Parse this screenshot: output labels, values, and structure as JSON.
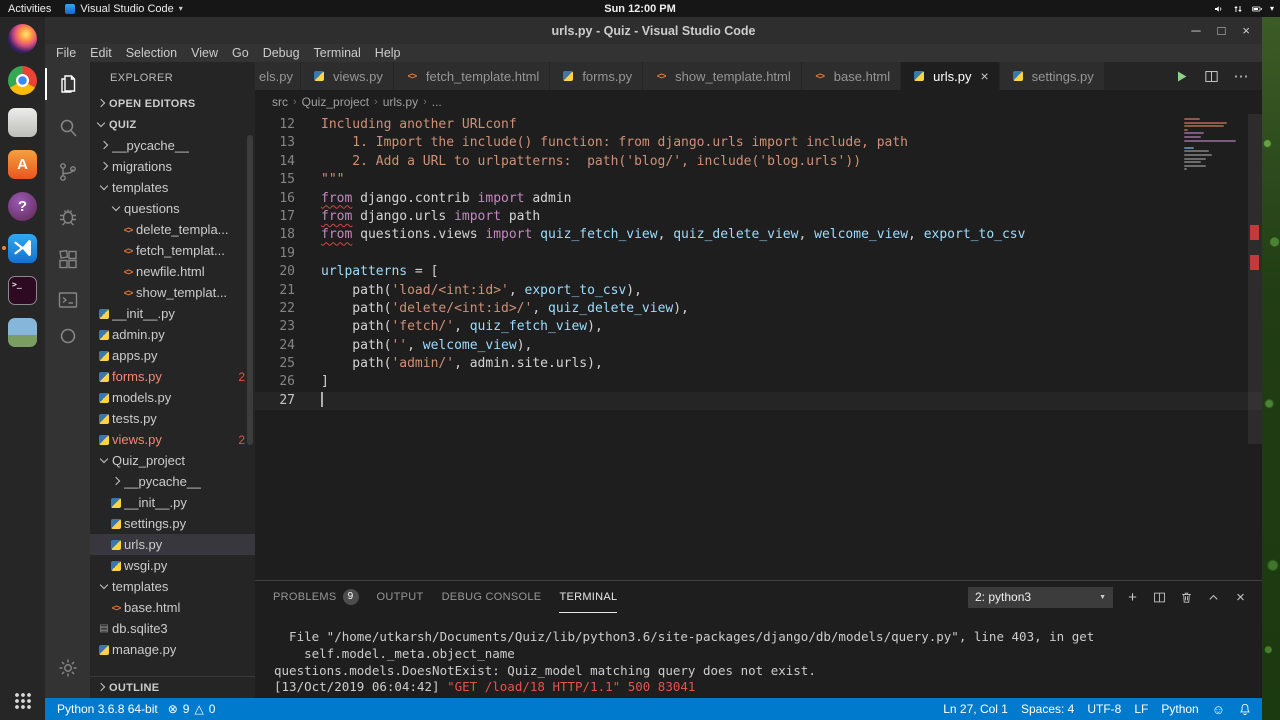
{
  "colors": {
    "status_bar_accent": "#007acc",
    "error_red": "#f14c4c",
    "list_error_foreground": "#f48771",
    "string_color": "#ce9178",
    "keyword_color": "#c586c0",
    "variable_color": "#9cdcfe"
  },
  "desktop": {
    "activities_label": "Activities",
    "focused_app_label": "Visual Studio Code",
    "clock": "Sun 12:00 PM",
    "indicator_icons": [
      "volume-icon",
      "network-icon",
      "battery-icon"
    ],
    "dock": [
      {
        "icon": "firefox-icon"
      },
      {
        "icon": "chrome-icon"
      },
      {
        "icon": "files-app-icon"
      },
      {
        "icon": "ubuntu-software-icon",
        "letter": "A"
      },
      {
        "icon": "help-icon",
        "letter": "?"
      },
      {
        "icon": "vscode-icon",
        "running": true
      },
      {
        "icon": "terminal-app-icon",
        "letter": ">_"
      },
      {
        "icon": "image-viewer-icon"
      }
    ]
  },
  "window": {
    "title": "urls.py - Quiz - Visual Studio Code",
    "controls": [
      {
        "name": "minimize-button",
        "glyph": "─"
      },
      {
        "name": "maximize-button",
        "glyph": "□"
      },
      {
        "name": "close-button",
        "glyph": "×"
      }
    ],
    "menus": [
      "File",
      "Edit",
      "Selection",
      "View",
      "Go",
      "Debug",
      "Terminal",
      "Help"
    ]
  },
  "activity_bar": {
    "top": [
      {
        "icon": "files-icon",
        "active": true
      },
      {
        "icon": "search-icon"
      },
      {
        "icon": "source-control-icon"
      },
      {
        "icon": "debug-icon"
      },
      {
        "icon": "extensions-icon"
      },
      {
        "icon": "terminal-box-icon",
        "small": true
      },
      {
        "icon": "ring-icon",
        "small": true
      }
    ],
    "bottom": [
      {
        "icon": "gear-icon"
      }
    ]
  },
  "explorer": {
    "title": "EXPLORER",
    "open_editors_label": "OPEN EDITORS",
    "workspace_label": "QUIZ",
    "outline_label": "OUTLINE",
    "tree": [
      {
        "label": "__pycache__",
        "kind": "folder",
        "depth": 1,
        "collapsed": true
      },
      {
        "label": "migrations",
        "kind": "folder",
        "depth": 1,
        "collapsed": true
      },
      {
        "label": "templates",
        "kind": "folder",
        "depth": 1
      },
      {
        "label": "questions",
        "kind": "folder",
        "depth": 2
      },
      {
        "label": "delete_templa...",
        "kind": "html",
        "depth": 3
      },
      {
        "label": "fetch_templat...",
        "kind": "html",
        "depth": 3
      },
      {
        "label": "newfile.html",
        "kind": "html",
        "depth": 3
      },
      {
        "label": "show_templat...",
        "kind": "html",
        "depth": 3
      },
      {
        "label": "__init__.py",
        "kind": "py",
        "depth": 1
      },
      {
        "label": "admin.py",
        "kind": "py",
        "depth": 1
      },
      {
        "label": "apps.py",
        "kind": "py",
        "depth": 1
      },
      {
        "label": "forms.py",
        "kind": "py",
        "depth": 1,
        "error": true,
        "badge": "2"
      },
      {
        "label": "models.py",
        "kind": "py",
        "depth": 1
      },
      {
        "label": "tests.py",
        "kind": "py",
        "depth": 1
      },
      {
        "label": "views.py",
        "kind": "py",
        "depth": 1,
        "error": true,
        "badge": "2"
      },
      {
        "label": "Quiz_project",
        "kind": "folder",
        "depth": 1
      },
      {
        "label": "__pycache__",
        "kind": "folder",
        "depth": 2,
        "collapsed": true
      },
      {
        "label": "__init__.py",
        "kind": "py",
        "depth": 2
      },
      {
        "label": "settings.py",
        "kind": "py",
        "depth": 2
      },
      {
        "label": "urls.py",
        "kind": "py",
        "depth": 2,
        "selected": true
      },
      {
        "label": "wsgi.py",
        "kind": "py",
        "depth": 2
      },
      {
        "label": "templates",
        "kind": "folder",
        "depth": 1
      },
      {
        "label": "base.html",
        "kind": "html",
        "depth": 2
      },
      {
        "label": "db.sqlite3",
        "kind": "db",
        "depth": 1
      },
      {
        "label": "manage.py",
        "kind": "py",
        "depth": 1
      }
    ]
  },
  "editor_tabs": [
    {
      "label": "els.py",
      "kind": "none",
      "cut": true
    },
    {
      "label": "views.py",
      "kind": "py"
    },
    {
      "label": "fetch_template.html",
      "kind": "html"
    },
    {
      "label": "forms.py",
      "kind": "py"
    },
    {
      "label": "show_template.html",
      "kind": "html"
    },
    {
      "label": "base.html",
      "kind": "html"
    },
    {
      "label": "urls.py",
      "kind": "py",
      "active": true,
      "closable": true
    },
    {
      "label": "settings.py",
      "kind": "py"
    }
  ],
  "tab_actions": [
    {
      "icon": "run-icon",
      "name": "run-python-file-button"
    },
    {
      "icon": "split-editor-icon",
      "name": "split-editor-button"
    },
    {
      "icon": "more-actions-icon",
      "name": "more-actions-button"
    }
  ],
  "breadcrumb": [
    "src",
    "Quiz_project",
    "urls.py",
    "..."
  ],
  "editor": {
    "language": "python",
    "cursor": {
      "line": 27,
      "col": 1
    },
    "lines": [
      {
        "n": 12,
        "tokens": [
          {
            "t": "Including another URLconf",
            "c": "str"
          }
        ]
      },
      {
        "n": 13,
        "tokens": [
          {
            "t": "    1. Import the include() function: from django.urls import include, path",
            "c": "str"
          }
        ]
      },
      {
        "n": 14,
        "tokens": [
          {
            "t": "    2. Add a URL to urlpatterns:  path('blog/', include('blog.urls'))",
            "c": "str"
          }
        ]
      },
      {
        "n": 15,
        "tokens": [
          {
            "t": "\"\"\"",
            "c": "str"
          }
        ]
      },
      {
        "n": 16,
        "tokens": [
          {
            "t": "from",
            "c": "kw",
            "u": true
          },
          {
            "t": " django.contrib ",
            "c": "def"
          },
          {
            "t": "import",
            "c": "kw"
          },
          {
            "t": " admin",
            "c": "def"
          }
        ]
      },
      {
        "n": 17,
        "tokens": [
          {
            "t": "from",
            "c": "kw",
            "u": true
          },
          {
            "t": " django.urls ",
            "c": "def"
          },
          {
            "t": "import",
            "c": "kw"
          },
          {
            "t": " path",
            "c": "def"
          }
        ]
      },
      {
        "n": 18,
        "tokens": [
          {
            "t": "from",
            "c": "kw",
            "u": true
          },
          {
            "t": " questions.views ",
            "c": "def"
          },
          {
            "t": "import",
            "c": "kw"
          },
          {
            "t": " ",
            "c": "def"
          },
          {
            "t": "quiz_fetch_view",
            "c": "var"
          },
          {
            "t": ", ",
            "c": "def"
          },
          {
            "t": "quiz_delete_view",
            "c": "var"
          },
          {
            "t": ", ",
            "c": "def"
          },
          {
            "t": "welcome_view",
            "c": "var"
          },
          {
            "t": ", ",
            "c": "def"
          },
          {
            "t": "export_to_csv",
            "c": "var"
          }
        ]
      },
      {
        "n": 19,
        "tokens": []
      },
      {
        "n": 20,
        "tokens": [
          {
            "t": "urlpatterns",
            "c": "var"
          },
          {
            "t": " = [",
            "c": "def"
          }
        ]
      },
      {
        "n": 21,
        "tokens": [
          {
            "t": "    path(",
            "c": "def"
          },
          {
            "t": "'load/<int:id>'",
            "c": "str"
          },
          {
            "t": ", ",
            "c": "def"
          },
          {
            "t": "export_to_csv",
            "c": "var"
          },
          {
            "t": "),",
            "c": "def"
          }
        ]
      },
      {
        "n": 22,
        "tokens": [
          {
            "t": "    path(",
            "c": "def"
          },
          {
            "t": "'delete/<int:id>/'",
            "c": "str"
          },
          {
            "t": ", ",
            "c": "def"
          },
          {
            "t": "quiz_delete_view",
            "c": "var"
          },
          {
            "t": "),",
            "c": "def"
          }
        ]
      },
      {
        "n": 23,
        "tokens": [
          {
            "t": "    path(",
            "c": "def"
          },
          {
            "t": "'fetch/'",
            "c": "str"
          },
          {
            "t": ", ",
            "c": "def"
          },
          {
            "t": "quiz_fetch_view",
            "c": "var"
          },
          {
            "t": "),",
            "c": "def"
          }
        ]
      },
      {
        "n": 24,
        "tokens": [
          {
            "t": "    path(",
            "c": "def"
          },
          {
            "t": "''",
            "c": "str"
          },
          {
            "t": ", ",
            "c": "def"
          },
          {
            "t": "welcome_view",
            "c": "var"
          },
          {
            "t": "),",
            "c": "def"
          }
        ]
      },
      {
        "n": 25,
        "tokens": [
          {
            "t": "    path(",
            "c": "def"
          },
          {
            "t": "'admin/'",
            "c": "str"
          },
          {
            "t": ", ",
            "c": "def"
          },
          {
            "t": "admin.site.urls",
            "c": "def"
          },
          {
            "t": "),",
            "c": "def"
          }
        ]
      },
      {
        "n": 26,
        "tokens": [
          {
            "t": "]",
            "c": "def"
          }
        ]
      },
      {
        "n": 27,
        "tokens": []
      }
    ]
  },
  "panel": {
    "tabs": [
      {
        "label": "PROBLEMS",
        "badge": "9"
      },
      {
        "label": "OUTPUT"
      },
      {
        "label": "DEBUG CONSOLE"
      },
      {
        "label": "TERMINAL",
        "active": true
      }
    ],
    "terminal_selector": "2: python3",
    "actions": [
      {
        "icon": "add-icon",
        "name": "new-terminal-button"
      },
      {
        "icon": "split-icon",
        "name": "split-terminal-button"
      },
      {
        "icon": "trash-icon",
        "name": "kill-terminal-button"
      },
      {
        "icon": "chevron-up-icon",
        "name": "maximize-panel-button"
      },
      {
        "icon": "close-icon",
        "name": "close-panel-button"
      }
    ],
    "terminal_lines": [
      [
        {
          "t": "  File \"/home/utkarsh/Documents/Quiz/lib/python3.6/site-packages/django/db/models/query.py\", line 403, in get",
          "c": "w"
        }
      ],
      [
        {
          "t": "    self.model._meta.object_name",
          "c": "w"
        }
      ],
      [
        {
          "t": "questions.models.DoesNotExist: Quiz_model matching query does not exist.",
          "c": "w"
        }
      ],
      [
        {
          "t": "[13/Oct/2019 06:04:42] ",
          "c": "w"
        },
        {
          "t": "\"GET /load/18 HTTP/1.1\" 500 83041",
          "c": "r"
        }
      ]
    ]
  },
  "status_bar": {
    "interpreter": "Python 3.6.8 64-bit",
    "errors": "9",
    "warnings": "0",
    "right_items": [
      "Ln 27, Col 1",
      "Spaces: 4",
      "UTF-8",
      "LF",
      "Python"
    ],
    "right_icons": [
      "smiley-icon",
      "bell-icon"
    ]
  }
}
